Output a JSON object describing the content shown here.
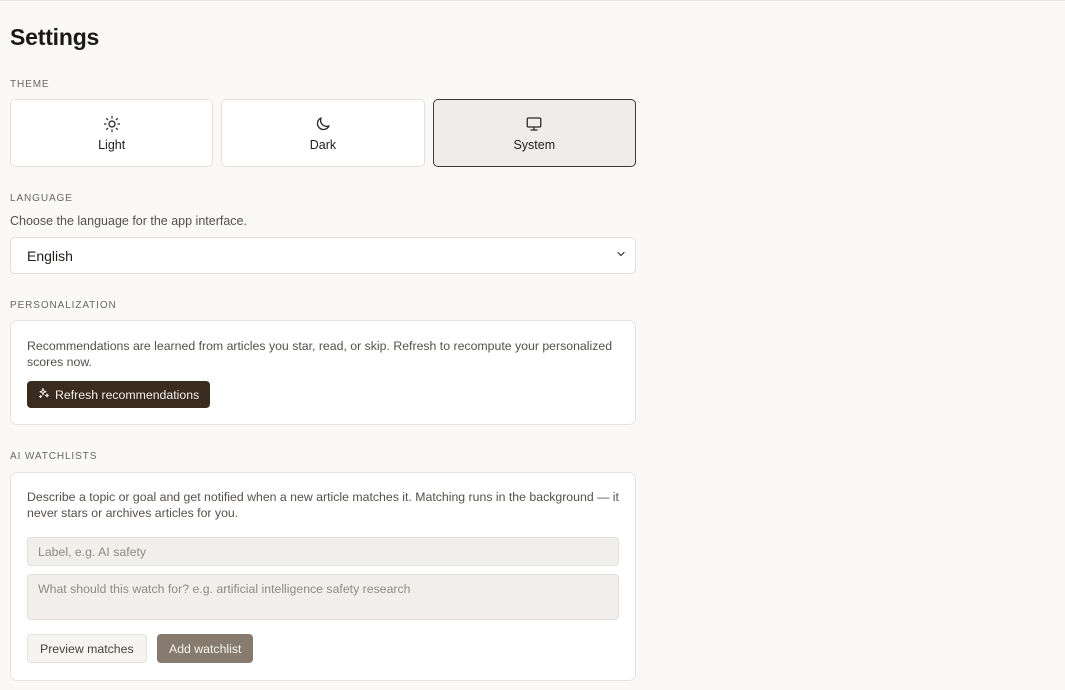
{
  "page": {
    "title": "Settings"
  },
  "theme": {
    "label": "THEME",
    "options": [
      {
        "label": "Light",
        "icon": "sun-icon",
        "active": false
      },
      {
        "label": "Dark",
        "icon": "moon-icon",
        "active": false
      },
      {
        "label": "System",
        "icon": "monitor-icon",
        "active": true
      }
    ]
  },
  "language": {
    "label": "LANGUAGE",
    "description": "Choose the language for the app interface.",
    "selected": "English"
  },
  "personalization": {
    "label": "PERSONALIZATION",
    "text": "Recommendations are learned from articles you star, read, or skip. Refresh to recompute your personalized scores now.",
    "button": "Refresh recommendations"
  },
  "watchlists": {
    "label": "AI WATCHLISTS",
    "text": "Describe a topic or goal and get notified when a new article matches it. Matching runs in the background — it never stars or archives articles for you.",
    "label_placeholder": "Label, e.g. AI safety",
    "query_placeholder": "What should this watch for? e.g. artificial intelligence safety research",
    "preview_button": "Preview matches",
    "add_button": "Add watchlist"
  },
  "colors": {
    "background": "#faf9f7",
    "primary_button": "#3a2b21",
    "secondary_button": "#877b70",
    "active_border": "#3c3a36"
  }
}
